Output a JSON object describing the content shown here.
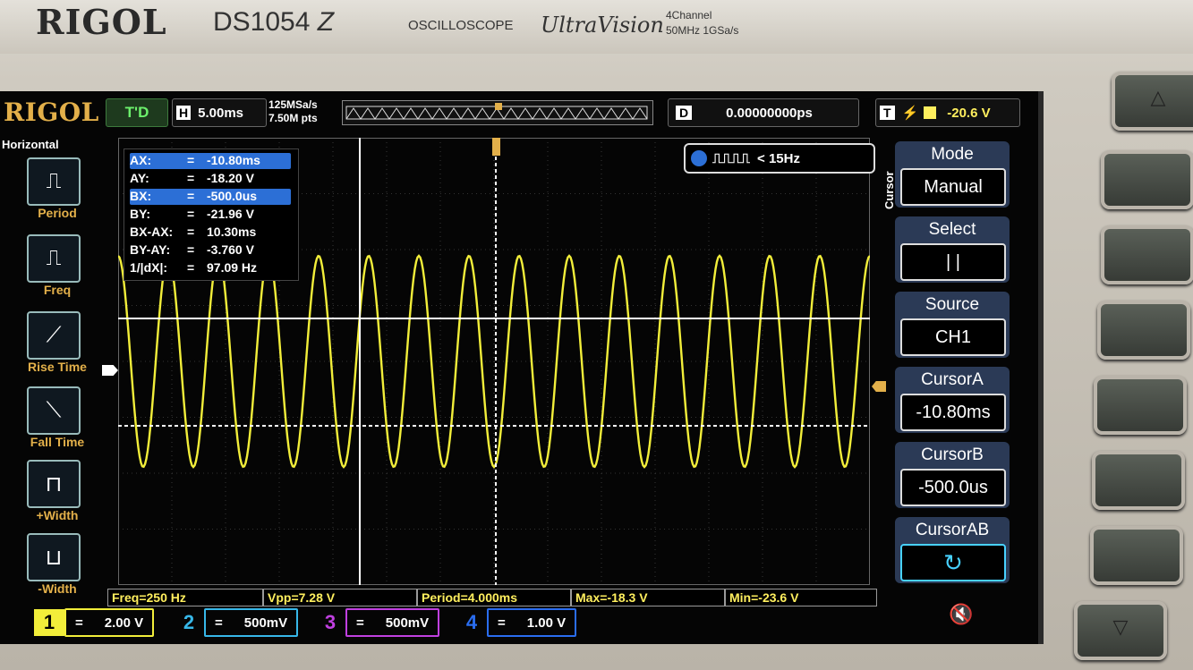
{
  "device": {
    "brand": "RIGOL",
    "model": "DS1054",
    "model_suffix": "Z",
    "type": "OSCILLOSCOPE",
    "series": "UltraVision",
    "spec_line1": "4Channel",
    "spec_line2": "50MHz  1GSa/s"
  },
  "topbar": {
    "logo": "RIGOL",
    "run_status": "T'D",
    "timebase_key": "H",
    "timebase_value": "5.00ms",
    "sample_rate": "125MSa/s",
    "memory_depth": "7.50M pts",
    "delay_key": "D",
    "delay_value": "0.00000000ps",
    "trigger_key": "T",
    "trigger_value": "-20.6 V"
  },
  "left_menu": {
    "title": "Horizontal",
    "items": [
      {
        "label": "Period",
        "icon": "period-icon"
      },
      {
        "label": "Freq",
        "icon": "freq-icon"
      },
      {
        "label": "Rise Time",
        "icon": "rise-time-icon"
      },
      {
        "label": "Fall Time",
        "icon": "fall-time-icon"
      },
      {
        "label": "+Width",
        "icon": "pos-width-icon"
      },
      {
        "label": "-Width",
        "icon": "neg-width-icon"
      }
    ]
  },
  "cursor_readout": [
    {
      "key": "AX:",
      "value": "-10.80ms",
      "selected": true
    },
    {
      "key": "AY:",
      "value": "-18.20 V",
      "selected": false
    },
    {
      "key": "BX:",
      "value": "-500.0us",
      "selected": true
    },
    {
      "key": "BY:",
      "value": "-21.96 V",
      "selected": false
    },
    {
      "key": "BX-AX:",
      "value": "10.30ms",
      "selected": false
    },
    {
      "key": "BY-AY:",
      "value": "-3.760 V",
      "selected": false
    },
    {
      "key": "1/|dX|:",
      "value": "97.09 Hz",
      "selected": false
    }
  ],
  "counter": {
    "text": "< 15Hz"
  },
  "right_menu": {
    "title": "Cursor",
    "items": [
      {
        "title": "Mode",
        "value": "Manual"
      },
      {
        "title": "Select",
        "value": "| |"
      },
      {
        "title": "Source",
        "value": "CH1"
      },
      {
        "title": "CursorA",
        "value": "-10.80ms"
      },
      {
        "title": "CursorB",
        "value": "-500.0us"
      },
      {
        "title": "CursorAB",
        "value": "↻"
      }
    ]
  },
  "measurements": [
    {
      "label": "Freq=250 Hz"
    },
    {
      "label": "Vpp=7.28 V"
    },
    {
      "label": "Period=4.000ms"
    },
    {
      "label": "Max=-18.3 V"
    },
    {
      "label": "Min=-23.6 V"
    }
  ],
  "channels": [
    {
      "num": "1",
      "scale": "2.00 V",
      "color": "#f2ee3a"
    },
    {
      "num": "2",
      "scale": "500mV",
      "color": "#37b7e8"
    },
    {
      "num": "3",
      "scale": "500mV",
      "color": "#c040e0"
    },
    {
      "num": "4",
      "scale": "1.00 V",
      "color": "#2a6df0"
    }
  ],
  "waveform": {
    "channel": "1",
    "color": "#f2ee3a",
    "cycles_on_screen": 15,
    "shape": "sine"
  },
  "colors": {
    "trace": "#f2ee3a",
    "menu_bg": "#2b3a56",
    "selection": "#2c6fd6",
    "accent_orange": "#e3b04a"
  }
}
